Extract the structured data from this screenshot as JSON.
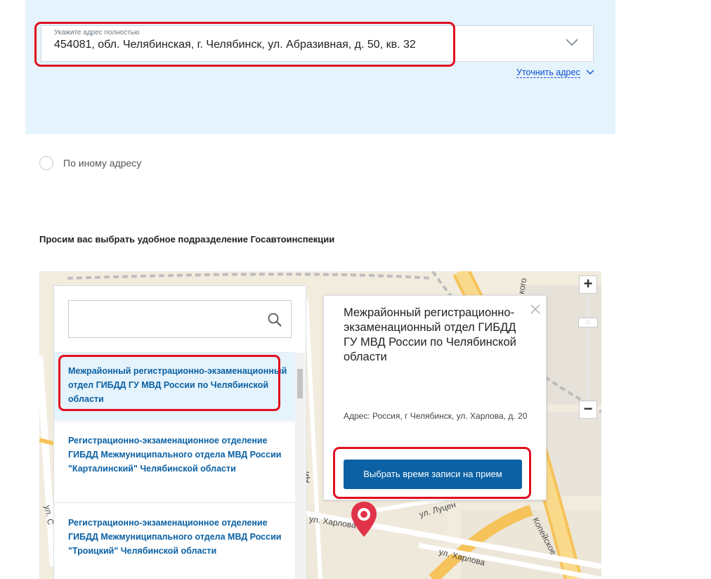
{
  "address": {
    "label": "Укажите адрес полностью",
    "value": "454081, обл. Челябинская, г. Челябинск, ул. Абразивная, д. 50, кв. 32",
    "refine_link": "Уточнить адрес"
  },
  "other_address": {
    "label": "По иному адресу"
  },
  "section_title": "Просим вас выбрать удобное подразделение Госавтоинспекции",
  "search": {
    "placeholder": ""
  },
  "offices": [
    {
      "name": "Межрайонный регистрационно-экзаменационный отдел ГИБДД ГУ МВД России по Челябинской области"
    },
    {
      "name": "Регистрационно-экзаменационное отделение ГИБДД Межмуниципального отдела МВД России \"Карталинский\" Челябинской области"
    },
    {
      "name": "Регистрационно-экзаменационное отделение ГИБДД Межмуниципального отдела МВД России \"Троицкий\" Челябинской области"
    }
  ],
  "popup": {
    "title": "Межрайонный регистрационно-экзаменационный отдел ГИБДД ГУ МВД России по Челябинской области",
    "address": "Адрес: Россия, г Челябинск, ул. Харлова, д. 20",
    "button": "Выбрать время записи на прием"
  },
  "map": {
    "zoom_in": "+",
    "zoom_out": "−",
    "streets": [
      "ул. Харлова",
      "ул. Харлова",
      "ул. Луцен",
      "Копейское",
      "ди",
      "ул. С",
      "кого"
    ]
  },
  "colors": {
    "accent": "#0b61a4",
    "highlight": "#e10f1f",
    "panel_bg": "#e5f3fc"
  }
}
